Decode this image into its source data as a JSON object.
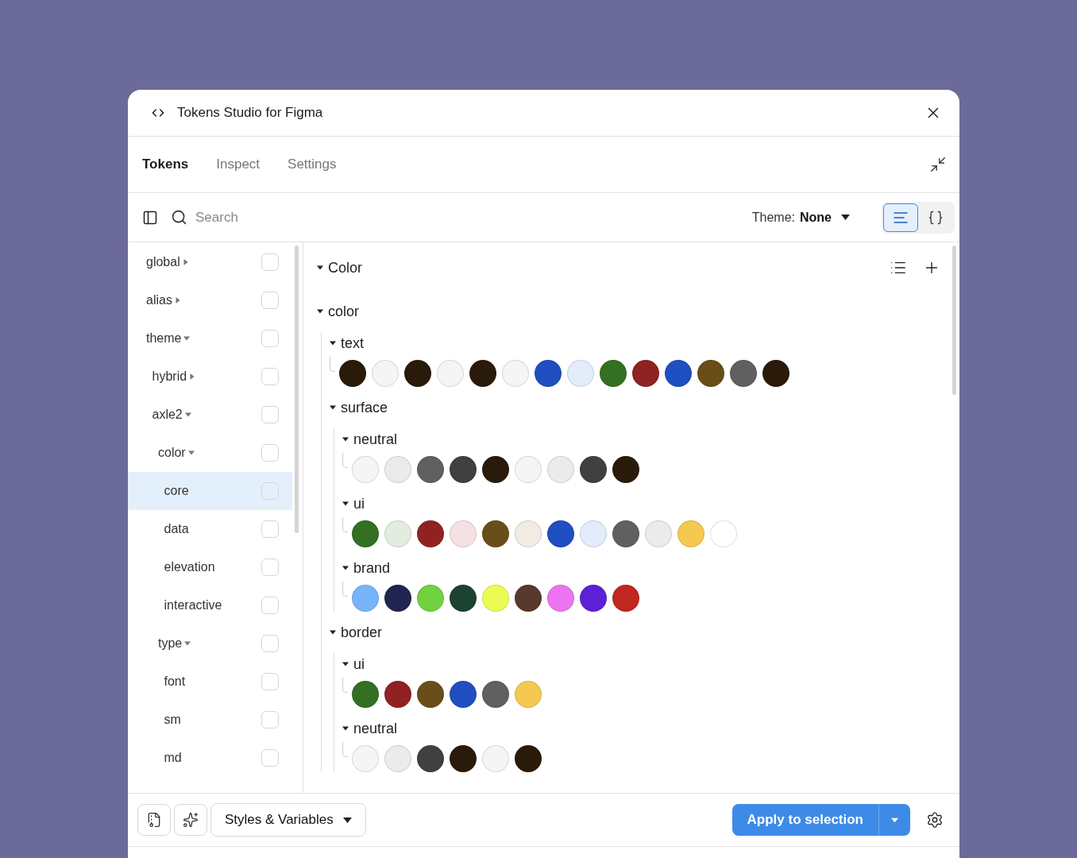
{
  "window": {
    "title": "Tokens Studio for Figma"
  },
  "tabs": [
    {
      "label": "Tokens",
      "selected": true
    },
    {
      "label": "Inspect",
      "selected": false
    },
    {
      "label": "Settings",
      "selected": false
    }
  ],
  "toolbar": {
    "search": {
      "placeholder": "Search"
    },
    "theme_label": "Theme:",
    "theme_value": "None",
    "views": [
      {
        "kind": "list",
        "selected": true
      },
      {
        "kind": "json",
        "selected": false
      }
    ]
  },
  "sidebar": {
    "items": [
      {
        "label": "global",
        "expanded": false,
        "checked": false,
        "selected": false
      },
      {
        "label": "alias",
        "expanded": false,
        "checked": false,
        "selected": false
      },
      {
        "label": "theme",
        "expanded": true,
        "checked": false,
        "selected": false,
        "children": [
          {
            "label": "hybrid",
            "expanded": false,
            "checked": false,
            "selected": false
          },
          {
            "label": "axle2",
            "expanded": true,
            "checked": false,
            "selected": false,
            "children": [
              {
                "label": "color",
                "expanded": true,
                "checked": false,
                "selected": false,
                "children": [
                  {
                    "label": "core",
                    "checked": false,
                    "selected": true
                  },
                  {
                    "label": "data",
                    "checked": false,
                    "selected": false
                  },
                  {
                    "label": "elevation",
                    "checked": false,
                    "selected": false
                  },
                  {
                    "label": "interactive",
                    "checked": false,
                    "selected": false
                  }
                ]
              },
              {
                "label": "type",
                "expanded": true,
                "checked": false,
                "selected": false,
                "children": [
                  {
                    "label": "font",
                    "checked": false,
                    "selected": false
                  },
                  {
                    "label": "sm",
                    "checked": false,
                    "selected": false
                  },
                  {
                    "label": "md",
                    "checked": false,
                    "selected": false
                  }
                ]
              }
            ]
          }
        ]
      }
    ]
  },
  "tokens": {
    "section": {
      "title": "Color",
      "expanded": true
    },
    "groups": [
      {
        "name": "color",
        "expanded": true,
        "children": [
          {
            "name": "text",
            "expanded": true,
            "swatches": [
              {
                "color": "#2a1a0a"
              },
              {
                "color": "#f5f5f5"
              },
              {
                "color": "#2a1a0a"
              },
              {
                "color": "#f5f5f5"
              },
              {
                "color": "#2a1a0a"
              },
              {
                "color": "#f5f5f5"
              },
              {
                "color": "#1f4fc0"
              },
              {
                "color": "#e2ecfb"
              },
              {
                "color": "#337021"
              },
              {
                "color": "#902222"
              },
              {
                "color": "#1f4fc0"
              },
              {
                "color": "#6a4e1a"
              },
              {
                "color": "#606060"
              },
              {
                "color": "#2a1a0a"
              }
            ]
          },
          {
            "name": "surface",
            "expanded": true,
            "children": [
              {
                "name": "neutral",
                "expanded": true,
                "swatches": [
                  {
                    "color": "#f5f5f5"
                  },
                  {
                    "color": "#ebebeb"
                  },
                  {
                    "color": "#606060"
                  },
                  {
                    "color": "#404040"
                  },
                  {
                    "color": "#2a1a0a"
                  },
                  {
                    "color": "#f5f5f5"
                  },
                  {
                    "color": "#ebebeb"
                  },
                  {
                    "color": "#404040"
                  },
                  {
                    "color": "#2a1a0a"
                  }
                ]
              },
              {
                "name": "ui",
                "expanded": true,
                "swatches": [
                  {
                    "color": "#337021"
                  },
                  {
                    "color": "#e2ede0"
                  },
                  {
                    "color": "#902222"
                  },
                  {
                    "color": "#f5e1e1"
                  },
                  {
                    "color": "#6a4e1a"
                  },
                  {
                    "color": "#f1ebe2"
                  },
                  {
                    "color": "#1f4fc0"
                  },
                  {
                    "color": "#e2ecfb"
                  },
                  {
                    "color": "#606060"
                  },
                  {
                    "color": "#ebebeb"
                  },
                  {
                    "color": "#f5c94f"
                  },
                  {
                    "color": "#ffffff"
                  }
                ]
              },
              {
                "name": "brand",
                "expanded": true,
                "swatches": [
                  {
                    "color": "#78b4fa"
                  },
                  {
                    "color": "#202550"
                  },
                  {
                    "color": "#72d13f"
                  },
                  {
                    "color": "#1c4230"
                  },
                  {
                    "color": "#ecfc52"
                  },
                  {
                    "color": "#58392e"
                  },
                  {
                    "color": "#ec74f0"
                  },
                  {
                    "color": "#5d20d7"
                  },
                  {
                    "color": "#c02720"
                  }
                ]
              }
            ]
          },
          {
            "name": "border",
            "expanded": true,
            "children": [
              {
                "name": "ui",
                "expanded": true,
                "swatches": [
                  {
                    "color": "#337021"
                  },
                  {
                    "color": "#902222"
                  },
                  {
                    "color": "#6a4e1a"
                  },
                  {
                    "color": "#1f4fc0"
                  },
                  {
                    "color": "#606060"
                  },
                  {
                    "color": "#f5c94f"
                  }
                ]
              },
              {
                "name": "neutral",
                "expanded": true,
                "swatches": [
                  {
                    "color": "#f5f5f5"
                  },
                  {
                    "color": "#ebebeb"
                  },
                  {
                    "color": "#404040"
                  },
                  {
                    "color": "#2a1a0a"
                  },
                  {
                    "color": "#f5f5f5"
                  },
                  {
                    "color": "#2a1a0a"
                  }
                ]
              }
            ]
          }
        ]
      }
    ]
  },
  "footer": {
    "mode_button": "Styles & Variables",
    "apply_button": "Apply to selection"
  }
}
